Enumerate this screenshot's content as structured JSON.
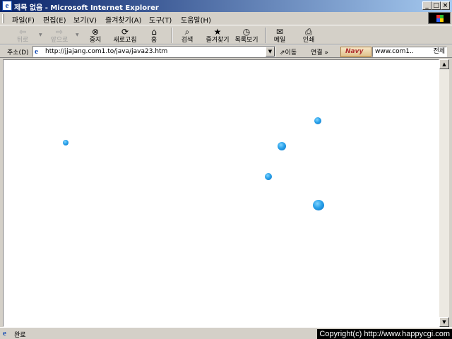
{
  "window": {
    "title": "제목 없음 - Microsoft Internet Explorer"
  },
  "menu": [
    {
      "label": "파일(F)"
    },
    {
      "label": "편집(E)"
    },
    {
      "label": "보기(V)"
    },
    {
      "label": "즐겨찾기(A)"
    },
    {
      "label": "도구(T)"
    },
    {
      "label": "도움말(H)"
    }
  ],
  "toolbar": {
    "back": "뒤로",
    "forward": "앞으로",
    "stop": "중지",
    "refresh": "새로고침",
    "home": "홈",
    "search": "검색",
    "favorites": "즐겨찾기",
    "history": "목록보기",
    "mail": "메일",
    "print": "인쇄"
  },
  "address": {
    "label": "주소(D)",
    "url": "http://jjajang.com1.to/java/java23.htm",
    "go": "이동",
    "links": "연결 »",
    "search_value": "www.com1..",
    "search_all": "전체"
  },
  "status": {
    "text": "완료"
  },
  "overlay": {
    "copyright": "Copyright(c) http://www.happycgi.com"
  },
  "colors": {
    "ball": "#2aa2ea",
    "titlebar": "#0a246a"
  }
}
